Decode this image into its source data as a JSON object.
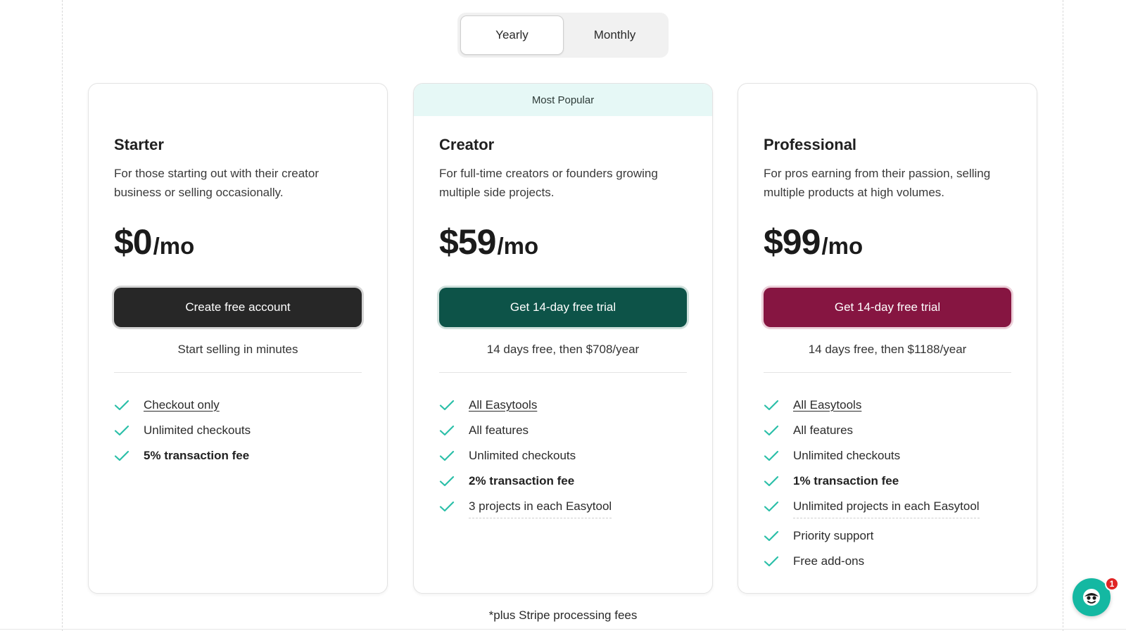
{
  "billing_toggle": {
    "yearly_label": "Yearly",
    "monthly_label": "Monthly",
    "selected": "Yearly"
  },
  "plans": [
    {
      "id": "starter",
      "name": "Starter",
      "description": "For those starting out with their creator business or selling occasionally.",
      "price_amount": "$0",
      "price_unit": "/mo",
      "cta_label": "Create free account",
      "cta_note": "Start selling in minutes",
      "features": [
        {
          "text": "Checkout only",
          "style": "link"
        },
        {
          "text": "Unlimited checkouts",
          "style": "plain"
        },
        {
          "text": "5% transaction fee",
          "style": "bold"
        }
      ]
    },
    {
      "id": "creator",
      "badge": "Most Popular",
      "name": "Creator",
      "description": "For full-time creators or founders growing multiple side projects.",
      "price_amount": "$59",
      "price_unit": "/mo",
      "cta_label": "Get 14-day free trial",
      "cta_note": "14 days free, then $708/year",
      "features": [
        {
          "text": "All Easytools",
          "style": "link"
        },
        {
          "text": "All features",
          "style": "plain"
        },
        {
          "text": "Unlimited checkouts",
          "style": "plain"
        },
        {
          "text": "2% transaction fee",
          "style": "bold"
        },
        {
          "text": "3 projects in each Easytool",
          "style": "dashed"
        }
      ]
    },
    {
      "id": "professional",
      "name": "Professional",
      "description": "For pros earning from their passion, selling multiple products at high volumes.",
      "price_amount": "$99",
      "price_unit": "/mo",
      "cta_label": "Get 14-day free trial",
      "cta_note": "14 days free, then $1188/year",
      "features": [
        {
          "text": "All Easytools",
          "style": "link"
        },
        {
          "text": "All features",
          "style": "plain"
        },
        {
          "text": "Unlimited checkouts",
          "style": "plain"
        },
        {
          "text": "1% transaction fee",
          "style": "bold"
        },
        {
          "text": "Unlimited projects in each Easytool",
          "style": "dashed"
        },
        {
          "text": "Priority support",
          "style": "plain"
        },
        {
          "text": "Free add-ons",
          "style": "plain"
        }
      ]
    }
  ],
  "footnote": "*plus Stripe processing fees",
  "chat_widget": {
    "icon": "chat-mascot-icon",
    "notification_count": "1"
  },
  "colors": {
    "check": "#2bbfa8",
    "starter_cta": "#272727",
    "creator_cta": "#0d5348",
    "professional_cta": "#861541",
    "badge_bg": "#e6f8f6",
    "chat_bg": "#14b8a2"
  }
}
